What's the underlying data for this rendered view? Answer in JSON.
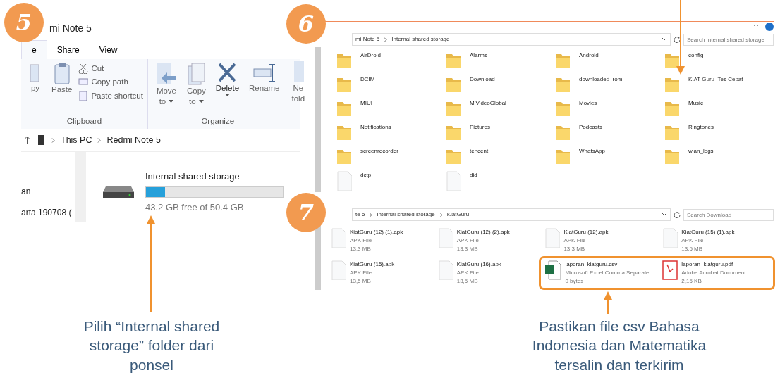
{
  "step5": {
    "badge": "5",
    "title": "mi Note 5",
    "tabs": [
      {
        "label": "e",
        "selected": true
      },
      {
        "label": "Share",
        "selected": false
      },
      {
        "label": "View",
        "selected": false
      }
    ],
    "clipboard": {
      "copy": "py",
      "paste": "Paste",
      "cut": "Cut",
      "copy_path": "Copy path",
      "paste_shortcut": "Paste shortcut",
      "group": "Clipboard"
    },
    "organize": {
      "move": [
        "Move",
        "to"
      ],
      "copy": [
        "Copy",
        "to"
      ],
      "delete": "Delete",
      "rename": "Rename",
      "new": [
        "Ne",
        "fold"
      ],
      "group": "Organize"
    },
    "path": [
      "This PC",
      "Redmi Note 5"
    ],
    "nav": [
      "an",
      "arta 190708 ("
    ],
    "drive": {
      "name": "Internal shared storage",
      "level": 0.14,
      "free": "43.2 GB free of 50.4 GB"
    },
    "caption": "Pilih “Internal shared storage” folder dari ponsel"
  },
  "step6": {
    "badge": "6",
    "path": [
      "mi Note 5",
      "Internal shared storage"
    ],
    "search": {
      "placeholder": "Search Internal shared storage"
    },
    "items": [
      {
        "name": "AirDroid",
        "kind": "folder"
      },
      {
        "name": "Alarms",
        "kind": "folder"
      },
      {
        "name": "Android",
        "kind": "folder"
      },
      {
        "name": "config",
        "kind": "folder"
      },
      {
        "name": "DCIM",
        "kind": "folder"
      },
      {
        "name": "Download",
        "kind": "folder"
      },
      {
        "name": "downloaded_rom",
        "kind": "folder"
      },
      {
        "name": "KIAT Guru_Tes Cepat",
        "kind": "folder"
      },
      {
        "name": "MIUI",
        "kind": "folder"
      },
      {
        "name": "MiVideoGlobal",
        "kind": "folder"
      },
      {
        "name": "Movies",
        "kind": "folder"
      },
      {
        "name": "Music",
        "kind": "folder"
      },
      {
        "name": "Notifications",
        "kind": "folder"
      },
      {
        "name": "Pictures",
        "kind": "folder"
      },
      {
        "name": "Podcasts",
        "kind": "folder"
      },
      {
        "name": "Ringtones",
        "kind": "folder"
      },
      {
        "name": "screenrecorder",
        "kind": "folder"
      },
      {
        "name": "tencent",
        "kind": "folder"
      },
      {
        "name": "WhatsApp",
        "kind": "folder"
      },
      {
        "name": "wlan_logs",
        "kind": "folder"
      },
      {
        "name": "dctp",
        "kind": "file"
      },
      {
        "name": "did",
        "kind": "file"
      }
    ]
  },
  "step7": {
    "badge": "7",
    "path": [
      "te 5",
      "Internal shared storage",
      "KiatGuru"
    ],
    "search": {
      "placeholder": "Search Download"
    },
    "files": [
      {
        "name": "KiatGuru (12) (1).apk",
        "type": "APK File",
        "size": "13,3 MB",
        "kind": "apk"
      },
      {
        "name": "KiatGuru (12) (2).apk",
        "type": "APK File",
        "size": "13,3 MB",
        "kind": "apk"
      },
      {
        "name": "KiatGuru (12).apk",
        "type": "APK File",
        "size": "13,3 MB",
        "kind": "apk"
      },
      {
        "name": "KiatGuru (15) (1).apk",
        "type": "APK File",
        "size": "13,5 MB",
        "kind": "apk"
      },
      {
        "name": "KiatGuru (15).apk",
        "type": "APK File",
        "size": "13,5 MB",
        "kind": "apk"
      },
      {
        "name": "KiatGuru (16).apk",
        "type": "APK File",
        "size": "13,5 MB",
        "kind": "apk"
      },
      {
        "name": "laporan_kiatguru.csv",
        "type": "Microsoft Excel Comma Separate...",
        "size": "0 bytes",
        "kind": "excel"
      },
      {
        "name": "laporan_kiatguru.pdf",
        "type": "Adobe Acrobat Document",
        "size": "2,15 KB",
        "kind": "pdf"
      }
    ],
    "caption": "Pastikan file csv Bahasa Indonesia dan Matematika tersalin dan terkirim"
  }
}
